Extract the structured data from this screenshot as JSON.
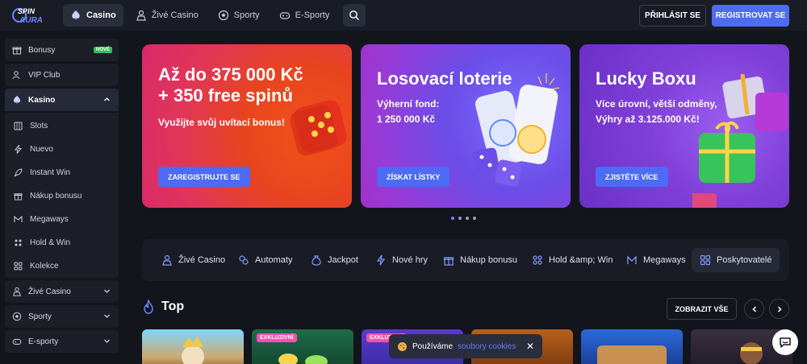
{
  "header": {
    "nav": [
      {
        "label": "Casino",
        "icon": "spade-icon",
        "active": true
      },
      {
        "label": "Živé Casino",
        "icon": "dealer-icon"
      },
      {
        "label": "Sporty",
        "icon": "soccer-ball-icon"
      },
      {
        "label": "E-Sporty",
        "icon": "gamepad-icon"
      }
    ],
    "login_label": "PŘIHLÁSIT SE",
    "register_label": "REGISTROVAT SE",
    "accent": "#4d6bf5"
  },
  "sidebar": {
    "items": [
      {
        "label": "Bonusy",
        "icon": "gift-icon",
        "badge": "NOVÉ"
      },
      {
        "label": "VIP Club",
        "icon": "vip-user-icon"
      },
      {
        "label": "Kasino",
        "icon": "spade-icon"
      }
    ],
    "casino_sub": [
      {
        "label": "Slots",
        "icon": "slots-icon"
      },
      {
        "label": "Nuevo",
        "icon": "lightning-icon"
      },
      {
        "label": "Instant Win",
        "icon": "rocket-icon"
      },
      {
        "label": "Nákup bonusu",
        "icon": "gift-icon"
      },
      {
        "label": "Megaways",
        "icon": "megaways-icon"
      },
      {
        "label": "Hold & Win",
        "icon": "hold-win-icon"
      },
      {
        "label": "Kolekce",
        "icon": "grid-icon"
      }
    ],
    "bottom": [
      {
        "label": "Živé Casino",
        "icon": "dealer-icon"
      },
      {
        "label": "Sporty",
        "icon": "soccer-ball-icon"
      },
      {
        "label": "E-sporty",
        "icon": "gamepad-icon"
      }
    ]
  },
  "banners": [
    {
      "title1": "Až do 375 000 Kč",
      "title2": "+ 350 free spinů",
      "line1": "Využijte svůj uvítací bonus!",
      "cta": "ZAREGISTRUJTE SE"
    },
    {
      "title1": "Losovací loterie",
      "line1": "Výherní fond:",
      "line2": "1 250 000 Kč",
      "cta": "ZÍSKAT LÍSTKY"
    },
    {
      "title1": "Lucky Boxu",
      "line1": "Více úrovní, větší odměny,",
      "line2": "Výhry až 3.125.000 Kč!",
      "cta": "ZJISTĚTE VÍCE"
    }
  ],
  "categories": [
    {
      "label": "Živé Casino",
      "icon": "dealer-icon"
    },
    {
      "label": "Automaty",
      "icon": "slots-icon"
    },
    {
      "label": "Jackpot",
      "icon": "money-bag-icon"
    },
    {
      "label": "Nové hry",
      "icon": "lightning-icon"
    },
    {
      "label": "Nákup bonusu",
      "icon": "gift-icon"
    },
    {
      "label": "Hold &amp; Win",
      "icon": "hold-win-icon"
    },
    {
      "label": "Megaways",
      "icon": "megaways-icon"
    },
    {
      "label": "Poskytovatelé",
      "icon": "grid-icon",
      "active": true
    }
  ],
  "top": {
    "title": "Top",
    "show_all": "ZOBRAZIT VŠE",
    "exclusive_label": "EXKLUZIVNÍ"
  },
  "cookie": {
    "text": "Používáme",
    "link": "soubory cookies",
    "close": "✕"
  }
}
